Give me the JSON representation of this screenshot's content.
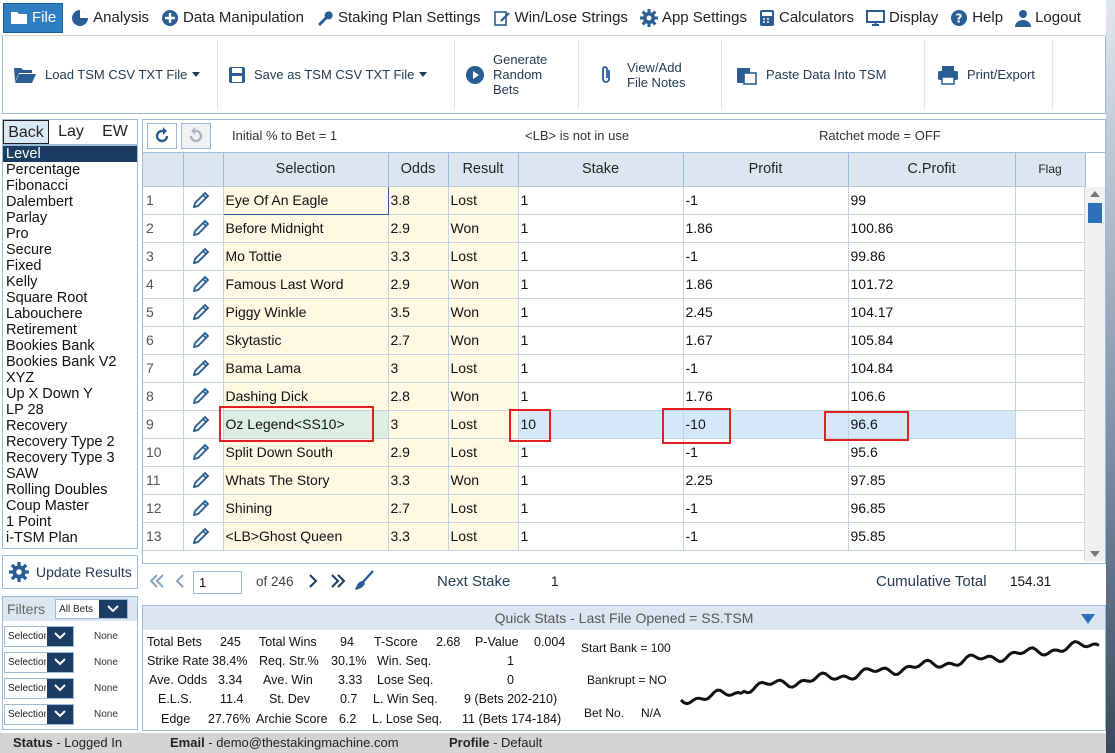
{
  "menu": {
    "items": [
      {
        "label": "File",
        "icon": "folder-icon",
        "active": true
      },
      {
        "label": "Analysis",
        "icon": "pie-chart-icon"
      },
      {
        "label": "Data Manipulation",
        "icon": "plus-circle-icon"
      },
      {
        "label": "Staking Plan Settings",
        "icon": "wrench-icon"
      },
      {
        "label": "Win/Lose Strings",
        "icon": "edit-doc-icon"
      },
      {
        "label": "App Settings",
        "icon": "gear-icon"
      },
      {
        "label": "Calculators",
        "icon": "calculator-icon"
      },
      {
        "label": "Display",
        "icon": "monitor-icon"
      },
      {
        "label": "Help",
        "icon": "question-icon"
      },
      {
        "label": "Logout",
        "icon": "user-icon"
      }
    ]
  },
  "toolbar": {
    "load_label": "Load TSM CSV TXT File",
    "save_label": "Save as TSM CSV TXT File",
    "generate_lines": [
      "Generate",
      "Random",
      "Bets"
    ],
    "notes_lines": [
      "View/Add",
      "File Notes"
    ],
    "paste_label": "Paste Data Into TSM",
    "print_label": "Print/Export"
  },
  "plan_tabs": [
    "Back",
    "Lay",
    "EW"
  ],
  "plans": [
    "Level",
    "Percentage",
    "Fibonacci",
    "Dalembert",
    "Parlay",
    "Pro",
    "Secure",
    "Fixed",
    "Kelly",
    "Square Root",
    "Labouchere",
    "Retirement",
    "Bookies Bank",
    "Bookies Bank V2",
    "XYZ",
    "Up X Down Y",
    "LP 28",
    "Recovery",
    "Recovery Type 2",
    "Recovery Type 3",
    "SAW",
    "Rolling Doubles",
    "Coup Master",
    "1 Point",
    "i-TSM Plan"
  ],
  "update_label": "Update Results",
  "filters": {
    "title": "Filters",
    "all_bets": "All Bets",
    "rows": [
      {
        "select": "Selection",
        "value": "None"
      },
      {
        "select": "Selection",
        "value": "None"
      },
      {
        "select": "Selection",
        "value": "None"
      },
      {
        "select": "Selection",
        "value": "None"
      }
    ]
  },
  "grid": {
    "initial_pct": "Initial % to Bet = 1",
    "lb_status": "<LB> is not in use",
    "ratchet": "Ratchet mode = OFF",
    "headers": [
      "Selection",
      "Odds",
      "Result",
      "Stake",
      "Profit",
      "C.Profit",
      "Flag"
    ],
    "rows": [
      {
        "n": "1",
        "sel": "Eye Of An Eagle",
        "odds": "3.8",
        "res": "Lost",
        "stake": "1",
        "profit": "-1",
        "cprofit": "99"
      },
      {
        "n": "2",
        "sel": "Before Midnight",
        "odds": "2.9",
        "res": "Won",
        "stake": "1",
        "profit": "1.86",
        "cprofit": "100.86"
      },
      {
        "n": "3",
        "sel": "Mo Tottie",
        "odds": "3.3",
        "res": "Lost",
        "stake": "1",
        "profit": "-1",
        "cprofit": "99.86"
      },
      {
        "n": "4",
        "sel": "Famous Last Word",
        "odds": "2.9",
        "res": "Won",
        "stake": "1",
        "profit": "1.86",
        "cprofit": "101.72"
      },
      {
        "n": "5",
        "sel": "Piggy Winkle",
        "odds": "3.5",
        "res": "Won",
        "stake": "1",
        "profit": "2.45",
        "cprofit": "104.17"
      },
      {
        "n": "6",
        "sel": "Skytastic",
        "odds": "2.7",
        "res": "Won",
        "stake": "1",
        "profit": "1.67",
        "cprofit": "105.84"
      },
      {
        "n": "7",
        "sel": "Bama Lama",
        "odds": "3",
        "res": "Lost",
        "stake": "1",
        "profit": "-1",
        "cprofit": "104.84"
      },
      {
        "n": "8",
        "sel": "Dashing Dick",
        "odds": "2.8",
        "res": "Won",
        "stake": "1",
        "profit": "1.76",
        "cprofit": "106.6"
      },
      {
        "n": "9",
        "sel": "Oz Legend<SS10>",
        "odds": "3",
        "res": "Lost",
        "stake": "10",
        "profit": "-10",
        "cprofit": "96.6"
      },
      {
        "n": "10",
        "sel": "Split Down South",
        "odds": "2.9",
        "res": "Lost",
        "stake": "1",
        "profit": "-1",
        "cprofit": "95.6"
      },
      {
        "n": "11",
        "sel": "Whats The Story",
        "odds": "3.3",
        "res": "Won",
        "stake": "1",
        "profit": "2.25",
        "cprofit": "97.85"
      },
      {
        "n": "12",
        "sel": "Shining",
        "odds": "2.7",
        "res": "Lost",
        "stake": "1",
        "profit": "-1",
        "cprofit": "96.85"
      },
      {
        "n": "13",
        "sel": "<LB>Ghost Queen",
        "odds": "3.3",
        "res": "Lost",
        "stake": "1",
        "profit": "-1",
        "cprofit": "95.85"
      }
    ]
  },
  "pager": {
    "page": "1",
    "of_pages": "of 246",
    "next_stake_label": "Next Stake",
    "next_stake_value": "1",
    "cumulative_label": "Cumulative Total",
    "cumulative_value": "154.31"
  },
  "quick_stats": {
    "title": "Quick Stats - Last File Opened = SS.TSM",
    "total_bets_label": "Total Bets",
    "total_bets": "245",
    "total_wins_label": "Total Wins",
    "total_wins": "94",
    "tscore_label": "T-Score",
    "tscore": "2.68",
    "pvalue_label": "P-Value",
    "pvalue": "0.004",
    "strike_label": "Strike Rate",
    "strike": "38.4%",
    "reqstr_label": "Req. Str.%",
    "reqstr": "30.1%",
    "winseq_label": "Win. Seq.",
    "winseq": "1",
    "aveodds_label": "Ave. Odds",
    "aveodds": "3.34",
    "avewin_label": "Ave. Win",
    "avewin": "3.33",
    "loseseq_label": "Lose Seq.",
    "loseseq": "0",
    "els_label": "E.L.S.",
    "els": "11.4",
    "stdev_label": "St. Dev",
    "stdev": "0.7",
    "lwinseq_label": "L. Win Seq.",
    "lwinseq": "9 (Bets 202-210)",
    "edge_label": "Edge",
    "edge": "27.76%",
    "archie_label": "Archie Score",
    "archie": "6.2",
    "lloseseq_label": "L. Lose Seq.",
    "lloseseq": "11 (Bets 174-184)",
    "start_bank": "Start Bank = 100",
    "bankrupt": "Bankrupt = NO",
    "betno_label": "Bet No.",
    "betno": "N/A"
  },
  "status": {
    "status_label": "Status",
    "status_value": " - Logged In",
    "email_label": "Email",
    "email_value": " - demo@thestakingmachine.com",
    "profile_label": "Profile",
    "profile_value": " - Default"
  },
  "colors": {
    "accent": "#2f7ec2",
    "dark": "#1b3d63",
    "highlight_red": "#e02020"
  }
}
